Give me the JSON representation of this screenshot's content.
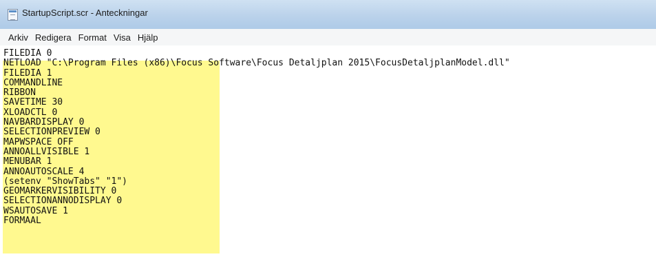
{
  "window": {
    "title": "StartupScript.scr - Anteckningar",
    "icon": "notepad-icon"
  },
  "menubar": {
    "items": [
      "Arkiv",
      "Redigera",
      "Format",
      "Visa",
      "Hjälp"
    ]
  },
  "editor": {
    "highlight_color": "#fff98f",
    "lines": [
      "FILEDIA 0",
      "NETLOAD \"C:\\Program Files (x86)\\Focus Software\\Focus Detaljplan 2015\\FocusDetaljplanModel.dll\"",
      "FILEDIA 1",
      "COMMANDLINE",
      "RIBBON",
      "SAVETIME 30",
      "XLOADCTL 0",
      "NAVBARDISPLAY 0",
      "SELECTIONPREVIEW 0",
      "MAPWSPACE OFF",
      "ANNOALLVISIBLE 1",
      "MENUBAR 1",
      "ANNOAUTOSCALE 4",
      "(setenv \"ShowTabs\" \"1\")",
      "GEOMARKERVISIBILITY 0",
      "SELECTIONANNODISPLAY 0",
      "WSAUTOSAVE 1",
      "FORMAAL"
    ]
  }
}
